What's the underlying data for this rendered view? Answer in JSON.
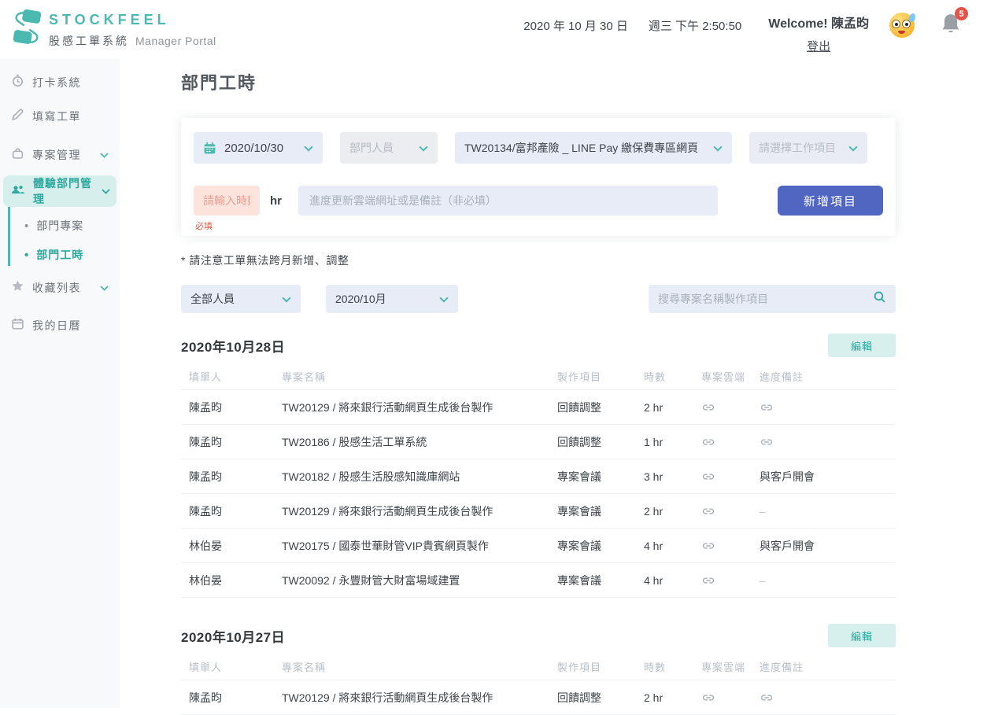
{
  "colors": {
    "accent_teal": "#4cb9b1",
    "accent_light_teal": "#d6efec",
    "primary_button_blue": "#5066c1",
    "badge_red": "#e25449",
    "required_pink_bg": "#fce4dd",
    "input_lavender_bg": "#e8ecf7"
  },
  "icons": {
    "logo": "stockfeel-ribbon-logo",
    "header": [
      "emoji-face-icon",
      "bell-icon"
    ],
    "sidebar": [
      "clock-icon",
      "pencil-icon",
      "bag-icon",
      "users-icon",
      "star-icon",
      "calendar-icon"
    ],
    "form": [
      "calendar-icon",
      "chevron-down-icon",
      "search-icon"
    ],
    "table": [
      "link-icon"
    ]
  },
  "header": {
    "brand": "STOCKFEEL",
    "system_name": "股感工單系統",
    "portal_label": "Manager Portal",
    "date": "2020 年 10 月 30 日",
    "weekday_time": "週三 下午 2:50:50",
    "welcome": "Welcome! 陳孟昀",
    "logout_label": "登出",
    "notification_count": "5"
  },
  "sidebar": {
    "items": [
      {
        "label": "打卡系統"
      },
      {
        "label": "填寫工單"
      },
      {
        "label": "專案管理"
      },
      {
        "label": "體驗部門管理"
      },
      {
        "label": "收藏列表"
      },
      {
        "label": "我的日曆"
      }
    ],
    "subitems": [
      {
        "label": "部門專案"
      },
      {
        "label": "部門工時"
      }
    ]
  },
  "main": {
    "page_title": "部門工時",
    "form": {
      "date_value": "2020/10/30",
      "staff_placeholder": "部門人員",
      "project_value": "TW20134/富邦產險 _ LINE Pay 繳保費專區網頁",
      "work_item_placeholder": "請選擇工作項目",
      "hours_placeholder": "請輸入時數",
      "hours_unit": "hr",
      "remark_placeholder": "進度更新雲端網址或是備註（非必填）",
      "required_hint": "必填",
      "add_button": "新增項目"
    },
    "note": "* 請注意工單無法跨月新增、調整",
    "filters": {
      "staff_value": "全部人員",
      "month_value": "2020/10月",
      "search_placeholder": "搜尋專案名稱製作項目"
    },
    "table_headers": [
      "填單人",
      "專案名稱",
      "製作項目",
      "時數",
      "專案雲端",
      "進度備註"
    ],
    "edit_button": "編輯",
    "sections": [
      {
        "date": "2020年10月28日",
        "rows": [
          {
            "name": "陳孟昀",
            "project": "TW20129 / 將來銀行活動網頁生成後台製作",
            "task": "回饋調整",
            "hours": "2 hr",
            "cloud": "link",
            "note": "link"
          },
          {
            "name": "陳孟昀",
            "project": "TW20186 / 股感生活工單系統",
            "task": "回饋調整",
            "hours": "1 hr",
            "cloud": "link",
            "note": "link"
          },
          {
            "name": "陳孟昀",
            "project": "TW20182 / 股感生活股感知識庫網站",
            "task": "專案會議",
            "hours": "3 hr",
            "cloud": "link",
            "note": "與客戶開會"
          },
          {
            "name": "陳孟昀",
            "project": "TW20129 / 將來銀行活動網頁生成後台製作",
            "task": "專案會議",
            "hours": "2 hr",
            "cloud": "link",
            "note": "-"
          },
          {
            "name": "林伯晏",
            "project": "TW20175 / 國泰世華財管VIP貴賓網頁製作",
            "task": "專案會議",
            "hours": "4 hr",
            "cloud": "link",
            "note": "與客戶開會"
          },
          {
            "name": "林伯晏",
            "project": "TW20092 / 永豐財管大財富場域建置",
            "task": "專案會議",
            "hours": "4 hr",
            "cloud": "link",
            "note": "-"
          }
        ]
      },
      {
        "date": "2020年10月27日",
        "rows": [
          {
            "name": "陳孟昀",
            "project": "TW20129 / 將來銀行活動網頁生成後台製作",
            "task": "回饋調整",
            "hours": "2 hr",
            "cloud": "link",
            "note": "link"
          }
        ]
      }
    ]
  }
}
